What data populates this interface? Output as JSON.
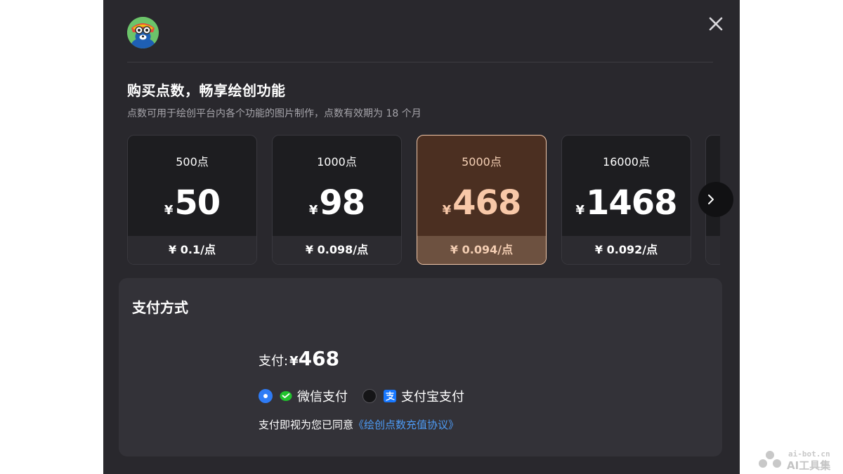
{
  "dialog": {
    "title": "购买点数，畅享绘创功能",
    "subtitle": "点数可用于绘创平台内各个功能的图片制作，点数有效期为 18 个月"
  },
  "packs": [
    {
      "points": "500点",
      "yen": "¥",
      "price": "50",
      "unit_price": "¥ 0.1/点",
      "selected": false
    },
    {
      "points": "1000点",
      "yen": "¥",
      "price": "98",
      "unit_price": "¥ 0.098/点",
      "selected": false
    },
    {
      "points": "5000点",
      "yen": "¥",
      "price": "468",
      "unit_price": "¥ 0.094/点",
      "selected": true
    },
    {
      "points": "16000点",
      "yen": "¥",
      "price": "1468",
      "unit_price": "¥ 0.092/点",
      "selected": false
    }
  ],
  "payment": {
    "title": "支付方式",
    "amount_label": "支付:",
    "currency": "¥",
    "amount": "468",
    "methods": [
      {
        "label": "微信支付",
        "icon": "wechat-pay-icon",
        "selected": true
      },
      {
        "label": "支付宝支付",
        "icon": "alipay-icon",
        "selected": false
      }
    ],
    "agreement_prefix": "支付即视为您已同意",
    "agreement_link": "《绘创点数充值协议》"
  },
  "watermark": {
    "url": "ai-bot.cn",
    "name": "AI工具集"
  },
  "colors": {
    "modal_bg": "#29282d",
    "card_bg": "#1d1d20",
    "selected_card_bg": "#4b2f21",
    "selected_border": "#f1c7a9",
    "selected_price": "#f8c8a8",
    "radio_active": "#2f7cf6",
    "link": "#4d9bf5"
  }
}
